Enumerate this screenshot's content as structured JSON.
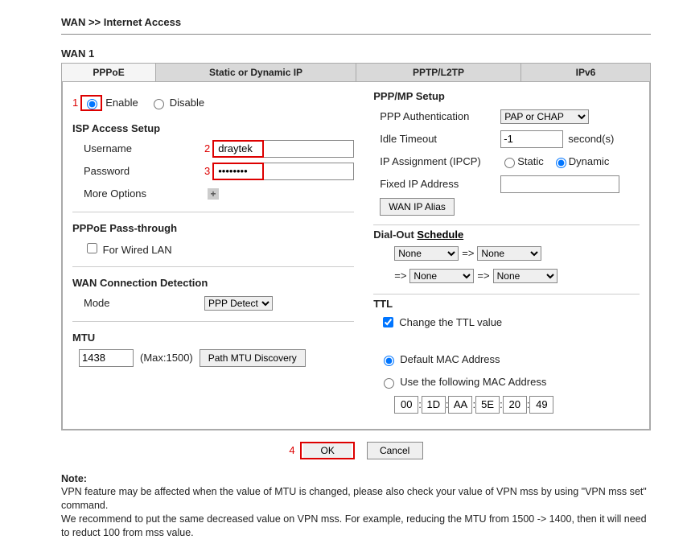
{
  "breadcrumb": "WAN >> Internet Access",
  "wan_title": "WAN 1",
  "tabs": {
    "pppoe": "PPPoE",
    "static": "Static or Dynamic IP",
    "pptp": "PPTP/L2TP",
    "ipv6": "IPv6"
  },
  "num1": "1",
  "num2": "2",
  "num3": "3",
  "num4": "4",
  "enable": "Enable",
  "disable": "Disable",
  "isp_setup": "ISP Access Setup",
  "username_lbl": "Username",
  "username_val": "draytek",
  "password_lbl": "Password",
  "password_val": "••••••••",
  "more_options": "More Options",
  "pass_through": "PPPoE Pass-through",
  "for_wired": "For Wired LAN",
  "wcd": "WAN Connection Detection",
  "mode_lbl": "Mode",
  "mode_val": "PPP Detect",
  "mtu_lbl": "MTU",
  "mtu_val": "1438",
  "mtu_max": "(Max:1500)",
  "path_mtu": "Path MTU Discovery",
  "pppmp": "PPP/MP Setup",
  "ppp_auth": "PPP Authentication",
  "ppp_auth_val": "PAP or CHAP",
  "idle": "Idle Timeout",
  "idle_val": "-1",
  "idle_unit": "second(s)",
  "ip_assign": "IP Assignment (IPCP)",
  "static_r": "Static",
  "dynamic_r": "Dynamic",
  "fixed_ip": "Fixed IP Address",
  "wan_ip_alias": "WAN IP Alias",
  "dial_schedule_pre": "Dial-Out ",
  "dial_schedule_link": "Schedule",
  "none": "None",
  "arrow": "=>",
  "ttl": "TTL",
  "change_ttl": "Change the TTL value",
  "default_mac": "Default MAC Address",
  "use_following": "Use the following MAC Address",
  "mac": {
    "a": "00",
    "b": "1D",
    "c": "AA",
    "d": "5E",
    "e": "20",
    "f": "49"
  },
  "ok": "OK",
  "cancel": "Cancel",
  "note_head": "Note:",
  "note1": "VPN feature may be affected when the value of MTU is changed, please also check your value of VPN mss by using \"VPN mss set\" command.",
  "note2": "We recommend to put the same decreased value on VPN mss. For example, reducing the MTU from 1500 -> 1400, then it will need to reduct 100 from mss value.",
  "colon": ":"
}
